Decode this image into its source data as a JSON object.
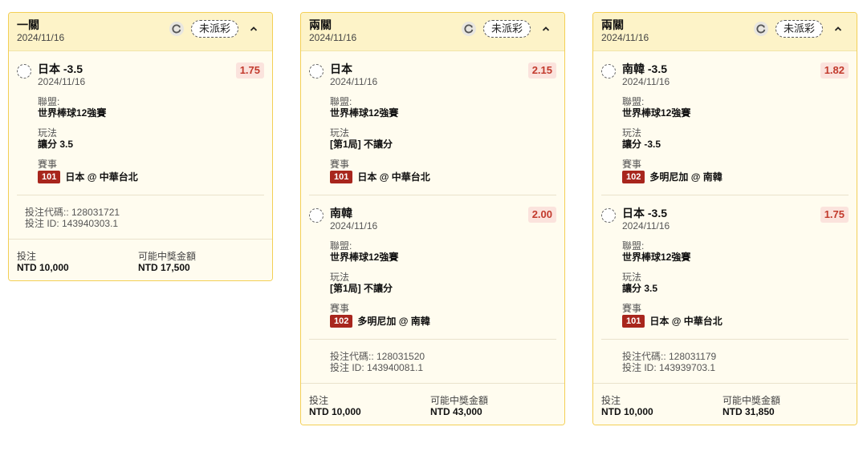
{
  "cards": [
    {
      "type": "一關",
      "date": "2024/11/16",
      "status": "未派彩",
      "selections": [
        {
          "title": "日本 -3.5",
          "date": "2024/11/16",
          "odds": "1.75",
          "league_label": "聯盟:",
          "league": "世界棒球12強賽",
          "play_label": "玩法",
          "play": "讓分 3.5",
          "event_label": "賽事",
          "event_no": "101",
          "event": "日本 @ 中華台北"
        }
      ],
      "bet_code": "投注代碼:: 128031721",
      "bet_id": "投注 ID: 143940303.1",
      "stake_label": "投注",
      "stake": "NTD 10,000",
      "payout_label": "可能中獎金額",
      "payout": "NTD 17,500"
    },
    {
      "type": "兩關",
      "date": "2024/11/16",
      "status": "未派彩",
      "selections": [
        {
          "title": "日本",
          "date": "2024/11/16",
          "odds": "2.15",
          "league_label": "聯盟:",
          "league": "世界棒球12強賽",
          "play_label": "玩法",
          "play": "[第1局] 不讓分",
          "event_label": "賽事",
          "event_no": "101",
          "event": "日本 @ 中華台北"
        },
        {
          "title": "南韓",
          "date": "2024/11/16",
          "odds": "2.00",
          "league_label": "聯盟:",
          "league": "世界棒球12強賽",
          "play_label": "玩法",
          "play": "[第1局] 不讓分",
          "event_label": "賽事",
          "event_no": "102",
          "event": "多明尼加 @ 南韓"
        }
      ],
      "bet_code": "投注代碼:: 128031520",
      "bet_id": "投注 ID: 143940081.1",
      "stake_label": "投注",
      "stake": "NTD 10,000",
      "payout_label": "可能中獎金額",
      "payout": "NTD 43,000"
    },
    {
      "type": "兩關",
      "date": "2024/11/16",
      "status": "未派彩",
      "selections": [
        {
          "title": "南韓 -3.5",
          "date": "2024/11/16",
          "odds": "1.82",
          "league_label": "聯盟:",
          "league": "世界棒球12強賽",
          "play_label": "玩法",
          "play": "讓分 -3.5",
          "event_label": "賽事",
          "event_no": "102",
          "event": "多明尼加 @ 南韓"
        },
        {
          "title": "日本 -3.5",
          "date": "2024/11/16",
          "odds": "1.75",
          "league_label": "聯盟:",
          "league": "世界棒球12強賽",
          "play_label": "玩法",
          "play": "讓分 3.5",
          "event_label": "賽事",
          "event_no": "101",
          "event": "日本 @ 中華台北"
        }
      ],
      "bet_code": "投注代碼:: 128031179",
      "bet_id": "投注 ID: 143939703.1",
      "stake_label": "投注",
      "stake": "NTD 10,000",
      "payout_label": "可能中獎金額",
      "payout": "NTD 31,850"
    }
  ],
  "icons": {
    "refresh": "refresh-icon",
    "collapse": "chevron-up-icon",
    "radio": "radio-circle"
  },
  "colors": {
    "card_border": "#f3cf55",
    "header_bg": "#fdf3c8",
    "odds_bg": "#fbe3dd",
    "odds_text": "#c23a2c",
    "event_badge": "#a8261d"
  }
}
